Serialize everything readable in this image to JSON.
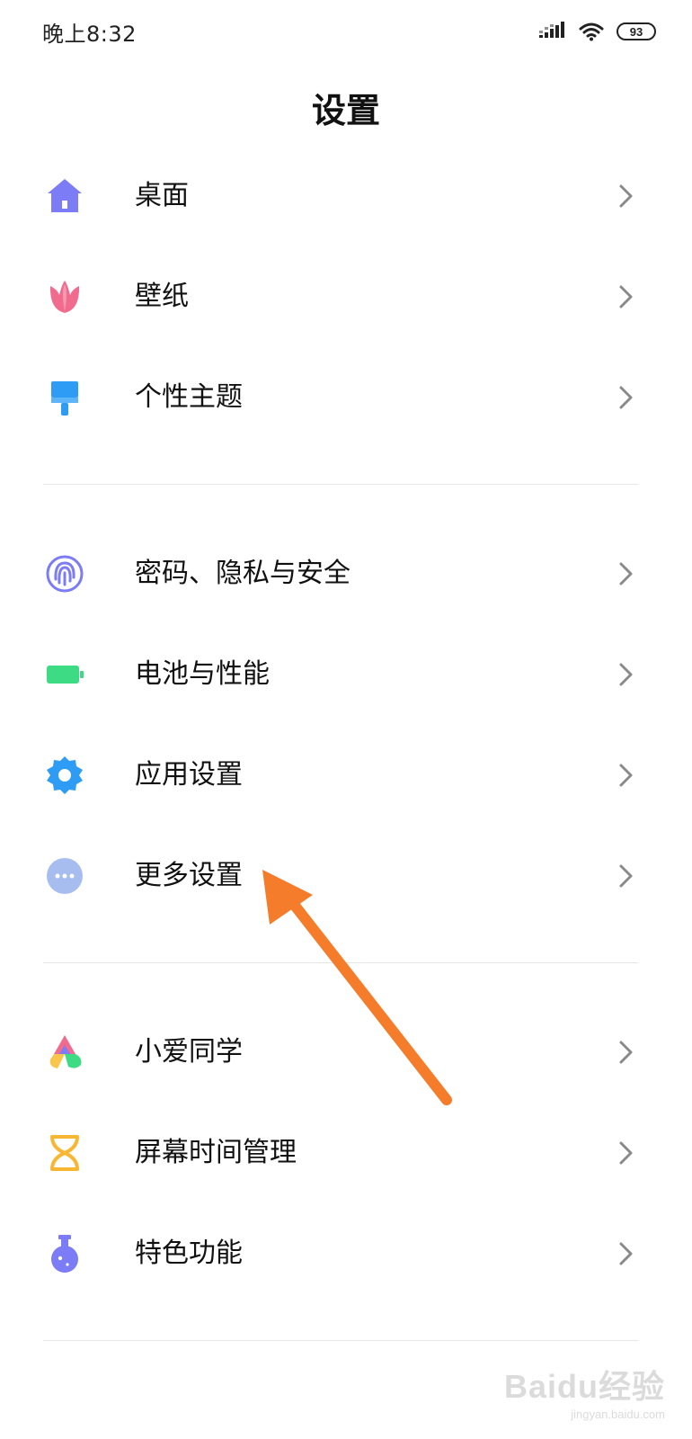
{
  "status_bar": {
    "time": "晚上8:32",
    "battery_level": "93"
  },
  "header": {
    "title": "设置"
  },
  "groups": [
    {
      "items": [
        {
          "label": "桌面",
          "icon": "home-icon",
          "color": "#7B7CF6"
        },
        {
          "label": "壁纸",
          "icon": "tulip-icon",
          "color": "#F06B8E"
        },
        {
          "label": "个性主题",
          "icon": "brush-icon",
          "color": "#2E9BF5"
        }
      ]
    },
    {
      "items": [
        {
          "label": "密码、隐私与安全",
          "icon": "fingerprint-icon",
          "color": "#7B7CF6"
        },
        {
          "label": "电池与性能",
          "icon": "battery-icon",
          "color": "#3DDC84"
        },
        {
          "label": "应用设置",
          "icon": "gear-icon",
          "color": "#2E9BF5"
        },
        {
          "label": "更多设置",
          "icon": "more-dots-icon",
          "color": "#A7BDF0"
        }
      ]
    },
    {
      "items": [
        {
          "label": "小爱同学",
          "icon": "xiaoai-icon",
          "color": "#F06B8E"
        },
        {
          "label": "屏幕时间管理",
          "icon": "hourglass-icon",
          "color": "#F7B733"
        },
        {
          "label": "特色功能",
          "icon": "flask-icon",
          "color": "#7B7CF6"
        }
      ]
    }
  ],
  "annotation": {
    "arrow_color": "#F57C2B"
  },
  "watermark": {
    "main": "Baidu经验",
    "url": "jingyan.baidu.com"
  }
}
